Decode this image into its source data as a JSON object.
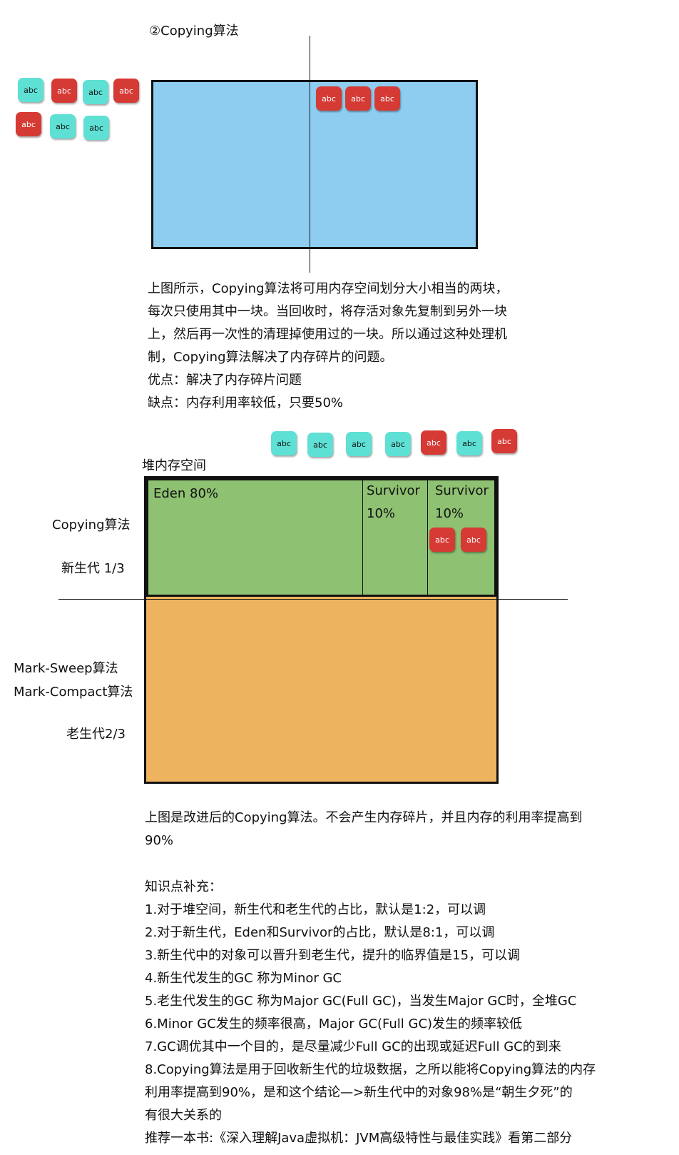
{
  "section_title": "②Copying算法",
  "object_label": "abc",
  "colors": {
    "live_object": "#5fe0d5",
    "dead_object": "#d63a35",
    "memory_space": "#8ecdf0",
    "young_generation": "#8ec172",
    "old_generation": "#edb35f"
  },
  "description1": {
    "lines": [
      "上图所示，Copying算法将可用内存空间划分大小相当的两块，",
      "每次只使用其中一块。当回收时，将存活对象先复制到另外一块",
      "上，然后再一次性的清理掉使用过的一块。所以通过这种处理机",
      "制，Copying算法解决了内存碎片的问题。",
      "优点：解决了内存碎片问题",
      "缺点：内存利用率较低，只要50%"
    ]
  },
  "heap": {
    "title": "堆内存空间",
    "eden_label": "Eden 80%",
    "survivor1": [
      "Survivor",
      "10%"
    ],
    "survivor2": [
      "Survivor",
      "10%"
    ],
    "young_labels": [
      "Copying算法",
      "新生代 1/3"
    ],
    "old_labels": [
      "Mark-Sweep算法",
      "Mark-Compact算法",
      "老生代2/3"
    ]
  },
  "description2": {
    "lines": [
      "上图是改进后的Copying算法。不会产生内存碎片，并且内存的利用率提高到",
      "90%"
    ]
  },
  "knowledge": {
    "title": "知识点补充：",
    "items": [
      "1.对于堆空间，新生代和老生代的占比，默认是1:2，可以调",
      "2.对于新生代，Eden和Survivor的占比，默认是8:1，可以调",
      "3.新生代中的对象可以晋升到老生代，提升的临界值是15，可以调",
      "4.新生代发生的GC 称为Minor GC",
      "5.老生代发生的GC 称为Major GC(Full GC)，当发生Major GC时，全堆GC",
      "6.Minor GC发生的频率很高，Major GC(Full GC)发生的频率较低",
      "7.GC调优其中一个目的，是尽量减少Full GC的出现或延迟Full GC的到来",
      "8.Copying算法是用于回收新生代的垃圾数据，之所以能将Copying算法的内存",
      "利用率提高到90%，是和这个结论—>新生代中的对象98%是“朝生夕死”的",
      "有很大关系的",
      "推荐一本书:《深入理解Java虚拟机：JVM高级特性与最佳实践》看第二部分"
    ]
  }
}
